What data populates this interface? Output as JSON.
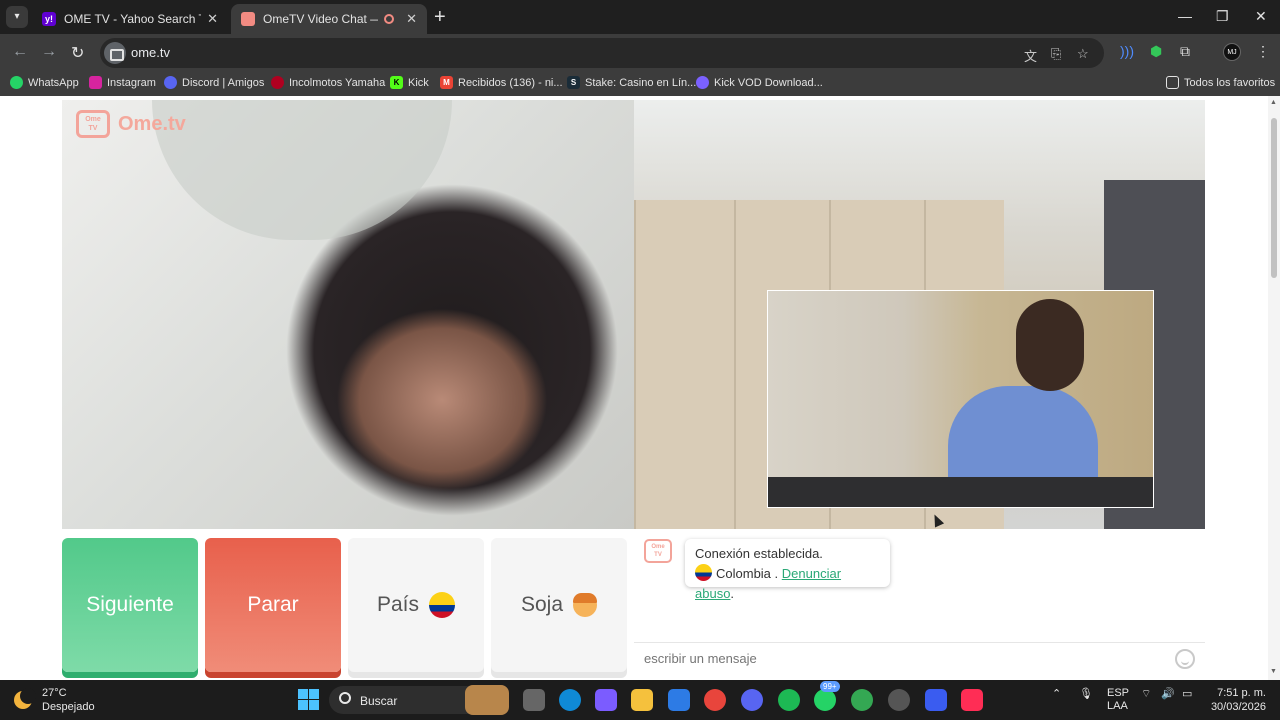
{
  "tabs": [
    {
      "title": "OME TV - Yahoo Search Tus res",
      "favicon": "yahoo-icon"
    },
    {
      "title": "OmeTV Video Chat — Alter",
      "favicon": "ometv-icon",
      "active": true
    }
  ],
  "window_controls": {
    "minimize": "—",
    "maximize": "❐",
    "close": "✕"
  },
  "address": {
    "url": "ome.tv"
  },
  "bookmarks": [
    {
      "label": "WhatsApp",
      "icon": "whatsapp-icon",
      "color": "#25d366"
    },
    {
      "label": "Instagram",
      "icon": "instagram-icon",
      "color": "#d6249f"
    },
    {
      "label": "Discord | Amigos",
      "icon": "discord-icon",
      "color": "#5865f2"
    },
    {
      "label": "Incolmotos Yamaha",
      "icon": "yamaha-icon",
      "color": "#b00020"
    },
    {
      "label": "Kick",
      "icon": "kick-icon",
      "color": "#53fc18"
    },
    {
      "label": "Recibidos (136) - ni...",
      "icon": "gmail-icon",
      "color": "#ea4335"
    },
    {
      "label": "Stake: Casino en Lín...",
      "icon": "stake-icon",
      "color": "#1a2c38"
    },
    {
      "label": "Kick VOD Download...",
      "icon": "kick-vod-icon",
      "color": "#7b61ff"
    }
  ],
  "all_bookmarks": "Todos los favoritos",
  "page": {
    "logo_text": "Ome.tv",
    "logo_badge_line1": "Ome",
    "logo_badge_line2": "TV",
    "buttons": {
      "next": "Siguiente",
      "stop": "Parar",
      "country": "País",
      "gender": "Soja"
    },
    "chat": {
      "status": "Conexión establecida.",
      "country": "Colombia .",
      "report_link": "Denunciar abuso",
      "report_suffix": ".",
      "input_placeholder": "escribir un mensaje"
    }
  },
  "taskbar": {
    "temperature": "27°C",
    "weather": "Despejado",
    "search_label": "Buscar",
    "badge": "99+",
    "lang_line1": "ESP",
    "lang_line2": "LAA",
    "time": "7:51 p. m.",
    "date": "30/03/2026"
  },
  "colors": {
    "next_button": "#52c98a",
    "stop_button": "#e8604c",
    "brand": "#f4a89c",
    "link": "#2aa876"
  }
}
